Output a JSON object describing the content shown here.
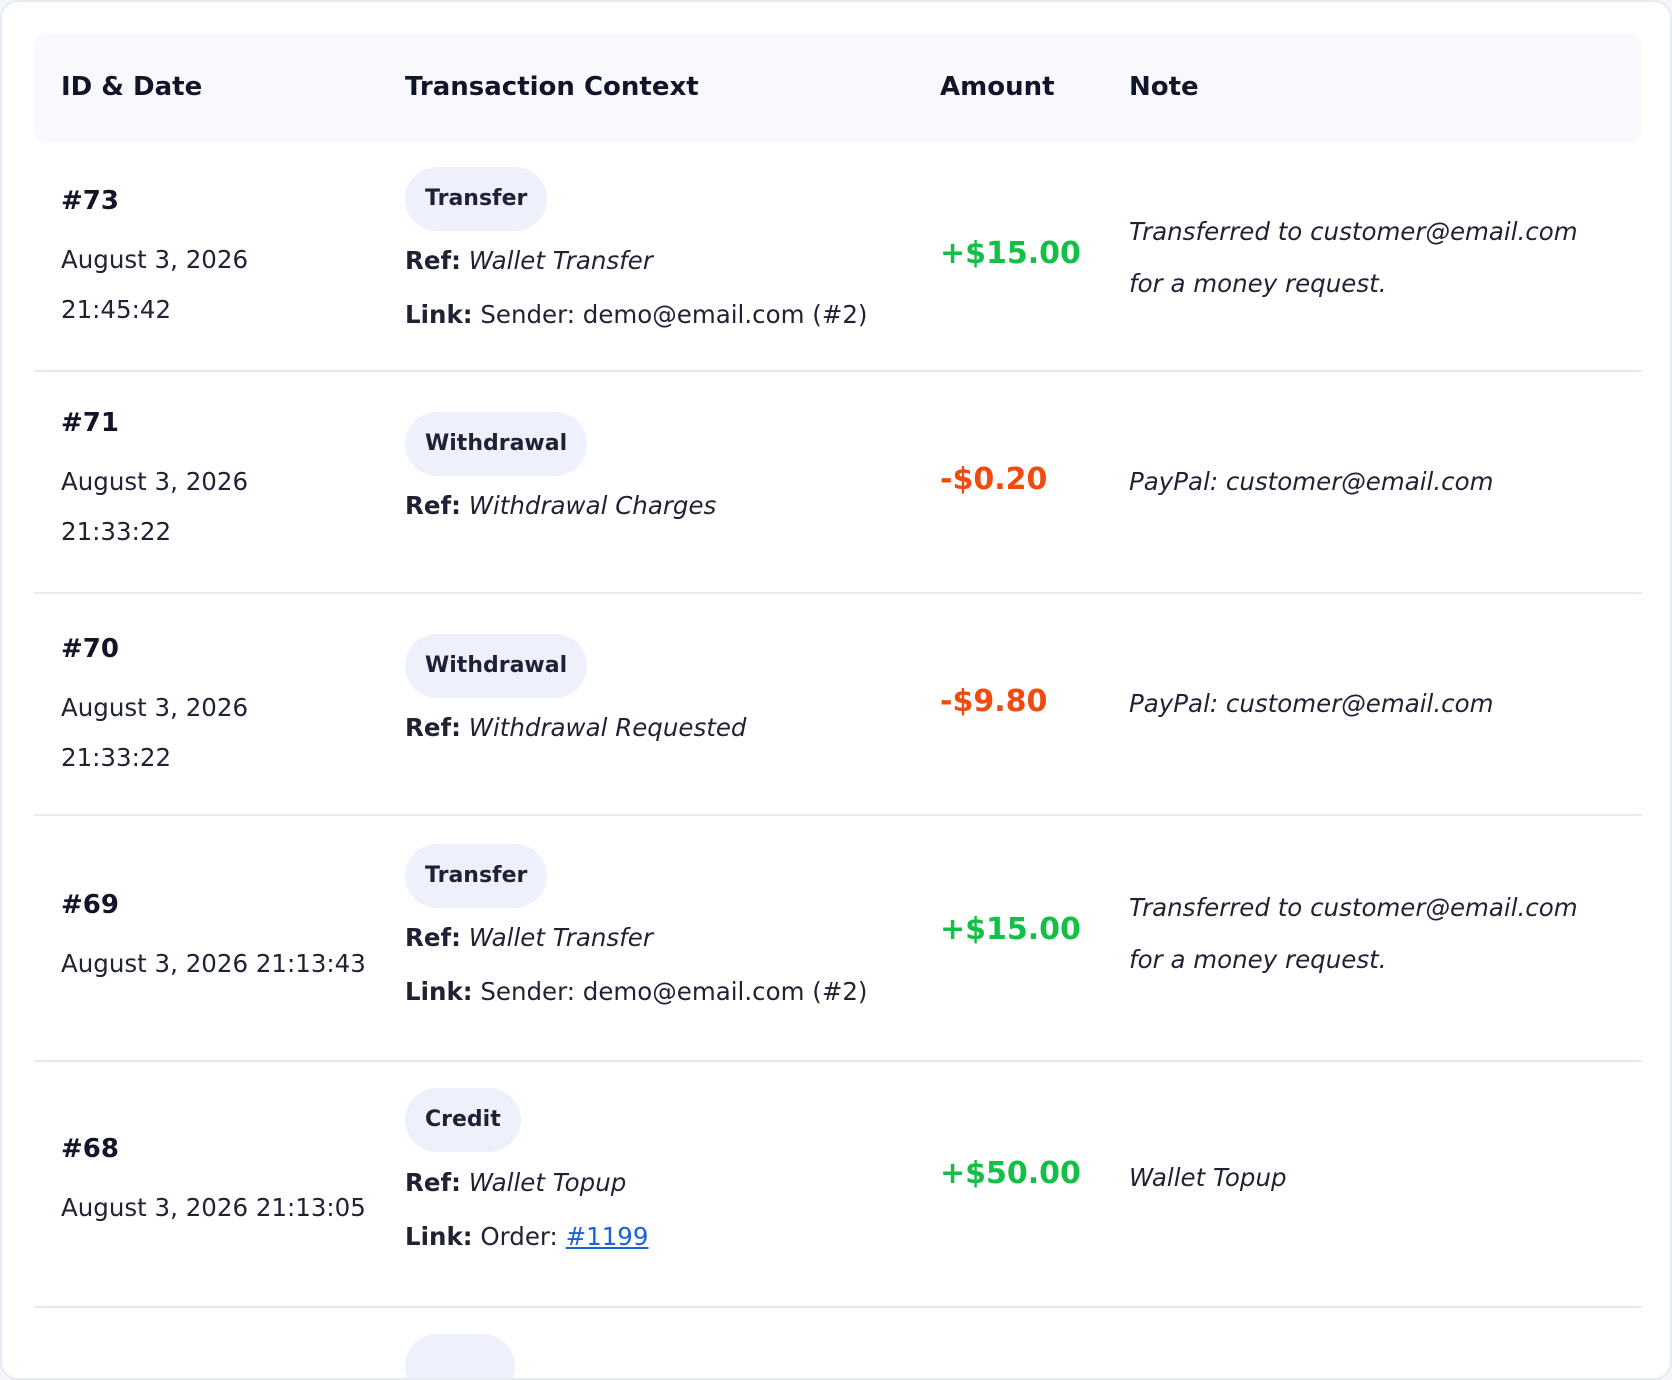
{
  "table": {
    "headers": {
      "id_date": "ID & Date",
      "context": "Transaction Context",
      "amount": "Amount",
      "note": "Note"
    },
    "ref_label": "Ref:",
    "link_label": "Link:",
    "rows": [
      {
        "id": "#73",
        "date": "August 3, 2026",
        "time": "21:45:42",
        "type": "Transfer",
        "ref": "Wallet Transfer",
        "link_text": "Sender: demo@email.com (#2)",
        "amount": "+$15.00",
        "note_line1": "Transferred to customer@email.com",
        "note_line2": "for a money request."
      },
      {
        "id": "#71",
        "date": "August 3, 2026",
        "time": "21:33:22",
        "type": "Withdrawal",
        "ref": "Withdrawal Charges",
        "amount": "-$0.20",
        "note_line1": "PayPal: customer@email.com"
      },
      {
        "id": "#70",
        "date": "August 3, 2026",
        "time": "21:33:22",
        "type": "Withdrawal",
        "ref": "Withdrawal Requested",
        "amount": "-$9.80",
        "note_line1": "PayPal: customer@email.com"
      },
      {
        "id": "#69",
        "datetime": "August 3, 2026 21:13:43",
        "type": "Transfer",
        "ref": "Wallet Transfer",
        "link_text": "Sender: demo@email.com (#2)",
        "amount": "+$15.00",
        "note_line1": "Transferred to customer@email.com",
        "note_line2": "for a money request."
      },
      {
        "id": "#68",
        "datetime": "August 3, 2026 21:13:05",
        "type": "Credit",
        "ref": "Wallet Topup",
        "link_prefix": "Order: ",
        "link_anchor": "#1199",
        "amount": "+$50.00",
        "note_line1": "Wallet Topup"
      }
    ]
  },
  "colors": {
    "positive": "#11c045",
    "negative": "#f04a0c",
    "link": "#1c63d8",
    "pill_bg": "#eef1fb",
    "header_bg": "#f8f9fc"
  }
}
